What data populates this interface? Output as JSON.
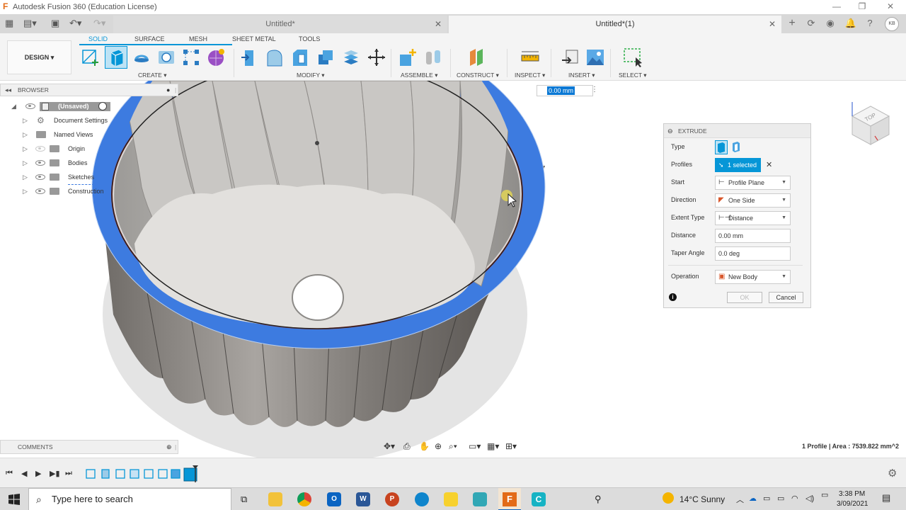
{
  "window": {
    "title": "Autodesk Fusion 360 (Education License)"
  },
  "tabs": [
    {
      "label": "Untitled*",
      "active": false
    },
    {
      "label": "Untitled*(1)",
      "active": true
    }
  ],
  "user_initials": "KB",
  "ribbon": {
    "workspace": "DESIGN",
    "tabs": [
      "SOLID",
      "SURFACE",
      "MESH",
      "SHEET METAL",
      "TOOLS"
    ],
    "active_tab": "SOLID",
    "groups": [
      "CREATE",
      "MODIFY",
      "ASSEMBLE",
      "CONSTRUCT",
      "INSPECT",
      "INSERT",
      "SELECT"
    ]
  },
  "browser": {
    "title": "BROWSER",
    "root": "(Unsaved)",
    "items": [
      "Document Settings",
      "Named Views",
      "Origin",
      "Bodies",
      "Sketches",
      "Construction"
    ]
  },
  "distance_input": {
    "value": "0.00 mm"
  },
  "extrude": {
    "title": "EXTRUDE",
    "type_label": "Type",
    "profiles_label": "Profiles",
    "profiles_value": "1 selected",
    "start_label": "Start",
    "start_value": "Profile Plane",
    "direction_label": "Direction",
    "direction_value": "One Side",
    "extent_label": "Extent Type",
    "extent_value": "Distance",
    "distance_label": "Distance",
    "distance_value": "0.00 mm",
    "taper_label": "Taper Angle",
    "taper_value": "0.0 deg",
    "operation_label": "Operation",
    "operation_value": "New Body",
    "ok_label": "OK",
    "cancel_label": "Cancel"
  },
  "viewcube_label": "TOP",
  "comments": {
    "label": "COMMENTS"
  },
  "status": {
    "text": "1 Profile | Area : 7539.822 mm^2"
  },
  "taskbar": {
    "search_placeholder": "Type here to search",
    "weather": "14°C  Sunny",
    "time": "3:38 PM",
    "date": "3/09/2021"
  },
  "colors": {
    "accent": "#0696d7",
    "extrude_highlight": "#3d7be0"
  }
}
